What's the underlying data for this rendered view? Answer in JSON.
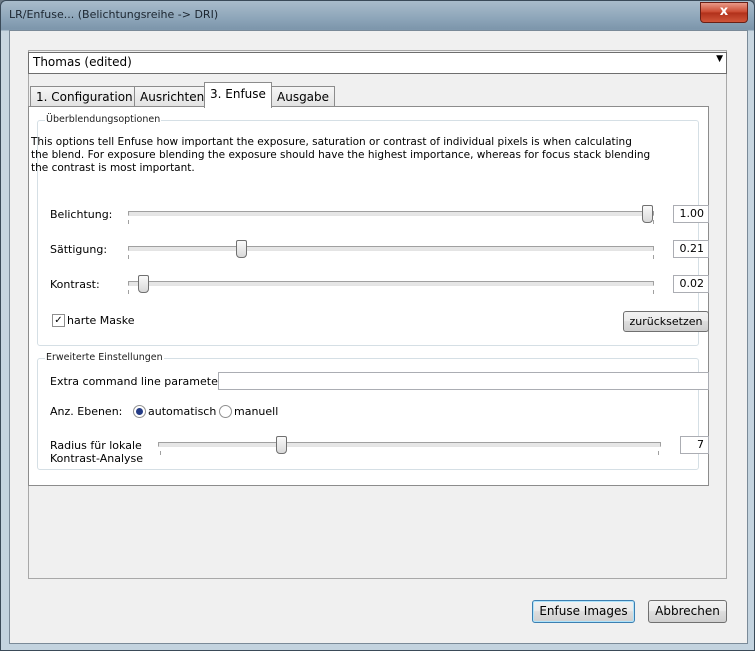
{
  "window": {
    "title": "LR/Enfuse... (Belichtungsreihe -> DRI)",
    "close_glyph": "x"
  },
  "preset": {
    "value": "Thomas (edited)",
    "arrow": "▼"
  },
  "tabs": [
    {
      "label": "1. Configuration"
    },
    {
      "label": "Ausrichten"
    },
    {
      "label": "3. Enfuse"
    },
    {
      "label": "Ausgabe"
    }
  ],
  "blend": {
    "title": "Überblendungsoptionen",
    "description": "This options tell Enfuse how important the exposure, saturation or contrast of individual pixels is when calculating the blend. For exposure blending the exposure should have the highest importance, whereas for focus stack blending the contrast is most important.",
    "sliders": [
      {
        "label": "Belichtung:",
        "value": "1.00",
        "level": 1.0
      },
      {
        "label": "Sättigung:",
        "value": "0.21",
        "level": 0.21
      },
      {
        "label": "Kontrast:",
        "value": "0.02",
        "level": 0.02
      }
    ],
    "hard_mask_label": "harte Maske",
    "hard_mask_checked": true,
    "check_glyph": "✓",
    "reset_label": "zurücksetzen"
  },
  "advanced": {
    "title": "Erweiterte Einstellungen",
    "extra_params_label": "Extra command line parameters:",
    "extra_params_value": "",
    "levels_label": "Anz. Ebenen:",
    "levels_options": [
      {
        "label": "automatisch",
        "selected": true
      },
      {
        "label": "manuell",
        "selected": false
      }
    ],
    "radius_label_line1": "Radius für lokale",
    "radius_label_line2": "Kontrast-Analyse",
    "radius_value": "7",
    "radius_level": 0.24
  },
  "buttons": {
    "enfuse": "Enfuse Images",
    "cancel": "Abbrechen"
  }
}
